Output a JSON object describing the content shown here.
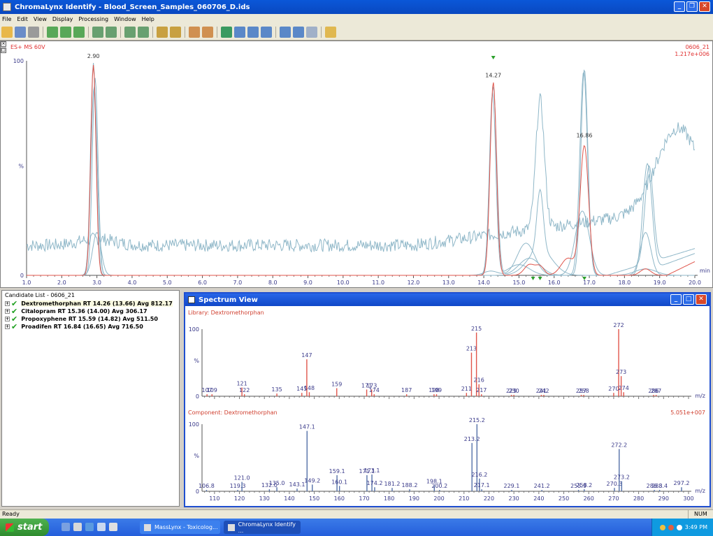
{
  "window": {
    "title": "ChromaLynx Identify - Blood_Screen_Samples_060706_D.ids"
  },
  "menu": [
    "File",
    "Edit",
    "View",
    "Display",
    "Processing",
    "Window",
    "Help"
  ],
  "chromatogram": {
    "mode_label": "ES+ MS 60V",
    "sample_label": "0606_21",
    "intensity_label": "1.217e+006",
    "y_labels": [
      "100",
      "%",
      "0"
    ],
    "x_unit": "min",
    "x_ticks": [
      "1.0",
      "2.0",
      "3.0",
      "4.0",
      "5.0",
      "6.0",
      "7.0",
      "8.0",
      "9.0",
      "10.0",
      "11.0",
      "12.0",
      "13.0",
      "14.0",
      "15.0",
      "16.0",
      "17.0",
      "18.0",
      "19.0",
      "20.0"
    ],
    "peak_labels": [
      {
        "rt": 2.9,
        "text": "2.90"
      },
      {
        "rt": 14.27,
        "text": "14.27"
      },
      {
        "rt": 16.86,
        "text": "16.86"
      }
    ]
  },
  "candidate_list": {
    "header": "Candidate List - 0606_21",
    "items": [
      {
        "text": "Dextromethorphan RT 14.26 (13.66) Avg 812.17"
      },
      {
        "text": "Citalopram RT 15.36 (14.00) Avg 306.17"
      },
      {
        "text": "Propoxyphene RT 15.59 (14.82) Avg 511.50"
      },
      {
        "text": "Proadifen RT 16.84 (16.65) Avg 716.50"
      }
    ]
  },
  "spectrum_view": {
    "title": "Spectrum View",
    "library_label": "Library: Dextromethorphan",
    "component_label": "Component: Dextromethorphan",
    "component_intensity": "5.051e+007",
    "y_labels": [
      "100",
      "%",
      "0"
    ],
    "x_unit": "m/z",
    "x_ticks": [
      "110",
      "120",
      "130",
      "140",
      "150",
      "160",
      "170",
      "180",
      "190",
      "200",
      "210",
      "220",
      "230",
      "240",
      "250",
      "260",
      "270",
      "280",
      "290",
      "300"
    ]
  },
  "chart_data": [
    {
      "type": "line",
      "title": "ES+ MS 60V",
      "xlabel": "min",
      "ylabel": "%",
      "xlim": [
        1.0,
        20.0
      ],
      "ylim": [
        0,
        100
      ],
      "peaks_rt": [
        2.9,
        14.27,
        16.86
      ]
    },
    {
      "type": "bar",
      "title": "Library: Dextromethorphan",
      "xlabel": "m/z",
      "ylabel": "%",
      "xlim": [
        105,
        300
      ],
      "ylim": [
        0,
        100
      ],
      "peaks": [
        {
          "mz": 107,
          "i": 3,
          "label": "107"
        },
        {
          "mz": 109,
          "i": 3,
          "label": "109"
        },
        {
          "mz": 121,
          "i": 13,
          "label": "121"
        },
        {
          "mz": 122,
          "i": 3,
          "label": "122"
        },
        {
          "mz": 135,
          "i": 4,
          "label": "135"
        },
        {
          "mz": 145,
          "i": 5,
          "label": "145"
        },
        {
          "mz": 147,
          "i": 55,
          "label": "147"
        },
        {
          "mz": 148,
          "i": 6,
          "label": "148"
        },
        {
          "mz": 159,
          "i": 12,
          "label": "159"
        },
        {
          "mz": 171,
          "i": 10,
          "label": "171"
        },
        {
          "mz": 173,
          "i": 10,
          "label": "173"
        },
        {
          "mz": 174,
          "i": 3,
          "label": "174"
        },
        {
          "mz": 187,
          "i": 3,
          "label": "187"
        },
        {
          "mz": 198,
          "i": 3,
          "label": "198"
        },
        {
          "mz": 199,
          "i": 3,
          "label": "199"
        },
        {
          "mz": 211,
          "i": 5,
          "label": "211"
        },
        {
          "mz": 213,
          "i": 65,
          "label": "213"
        },
        {
          "mz": 215,
          "i": 95,
          "label": "215"
        },
        {
          "mz": 216,
          "i": 18,
          "label": "216"
        },
        {
          "mz": 217,
          "i": 3,
          "label": "217"
        },
        {
          "mz": 229,
          "i": 2,
          "label": "229"
        },
        {
          "mz": 230,
          "i": 2,
          "label": "230"
        },
        {
          "mz": 241,
          "i": 2,
          "label": "241"
        },
        {
          "mz": 242,
          "i": 2,
          "label": "242"
        },
        {
          "mz": 257,
          "i": 2,
          "label": "257"
        },
        {
          "mz": 258,
          "i": 2,
          "label": "258"
        },
        {
          "mz": 270,
          "i": 5,
          "label": "270"
        },
        {
          "mz": 272,
          "i": 100,
          "label": "272"
        },
        {
          "mz": 273,
          "i": 30,
          "label": "273"
        },
        {
          "mz": 274,
          "i": 6,
          "label": "274"
        },
        {
          "mz": 286,
          "i": 2,
          "label": "286"
        },
        {
          "mz": 287,
          "i": 2,
          "label": "287"
        }
      ]
    },
    {
      "type": "bar",
      "title": "Component: Dextromethorphan",
      "xlabel": "m/z",
      "ylabel": "%",
      "xlim": [
        105,
        300
      ],
      "ylim": [
        0,
        100
      ],
      "peaks": [
        {
          "mz": 106.8,
          "i": 2,
          "label": "106.8"
        },
        {
          "mz": 119.3,
          "i": 2,
          "label": "119.3"
        },
        {
          "mz": 121.0,
          "i": 14,
          "label": "121.0"
        },
        {
          "mz": 132.0,
          "i": 3,
          "label": "132.0"
        },
        {
          "mz": 135.0,
          "i": 6,
          "label": "135.0"
        },
        {
          "mz": 143.1,
          "i": 4,
          "label": "143.1"
        },
        {
          "mz": 147.1,
          "i": 90,
          "label": "147.1"
        },
        {
          "mz": 149.2,
          "i": 10,
          "label": "149.2"
        },
        {
          "mz": 159.1,
          "i": 24,
          "label": "159.1"
        },
        {
          "mz": 160.1,
          "i": 8,
          "label": "160.1"
        },
        {
          "mz": 171.1,
          "i": 24,
          "label": "171.1"
        },
        {
          "mz": 173.1,
          "i": 25,
          "label": "173.1"
        },
        {
          "mz": 174.2,
          "i": 6,
          "label": "174.2"
        },
        {
          "mz": 181.2,
          "i": 5,
          "label": "181.2"
        },
        {
          "mz": 188.2,
          "i": 3,
          "label": "188.2"
        },
        {
          "mz": 198.1,
          "i": 9,
          "label": "198.1"
        },
        {
          "mz": 200.2,
          "i": 2,
          "label": "200.2"
        },
        {
          "mz": 213.2,
          "i": 72,
          "label": "213.2"
        },
        {
          "mz": 215.2,
          "i": 100,
          "label": "215.2"
        },
        {
          "mz": 216.2,
          "i": 19,
          "label": "216.2"
        },
        {
          "mz": 217.1,
          "i": 3,
          "label": "217.1"
        },
        {
          "mz": 229.1,
          "i": 2,
          "label": "229.1"
        },
        {
          "mz": 241.2,
          "i": 2,
          "label": "241.2"
        },
        {
          "mz": 255.9,
          "i": 2,
          "label": "255.9"
        },
        {
          "mz": 258.2,
          "i": 3,
          "label": "258.2"
        },
        {
          "mz": 270.3,
          "i": 5,
          "label": "270.3"
        },
        {
          "mz": 272.2,
          "i": 63,
          "label": "272.2"
        },
        {
          "mz": 273.2,
          "i": 15,
          "label": "273.2"
        },
        {
          "mz": 286.3,
          "i": 2,
          "label": "286.3"
        },
        {
          "mz": 288.4,
          "i": 2,
          "label": "288.4"
        },
        {
          "mz": 297.2,
          "i": 6,
          "label": "297.2"
        }
      ]
    }
  ],
  "status": {
    "left": "Ready",
    "right": "NUM"
  },
  "taskbar": {
    "start_label": "start",
    "tasks": [
      "MassLynx - Toxicolog...",
      "ChromaLynx Identify ..."
    ],
    "clock": "3:49 PM"
  },
  "colors": {
    "red_trace": "#e0554b",
    "blue_trace": "#8fb7c8",
    "library_bar": "#e0554b",
    "component_bar": "#5470a8",
    "axis_text": "#3a3a8a"
  }
}
